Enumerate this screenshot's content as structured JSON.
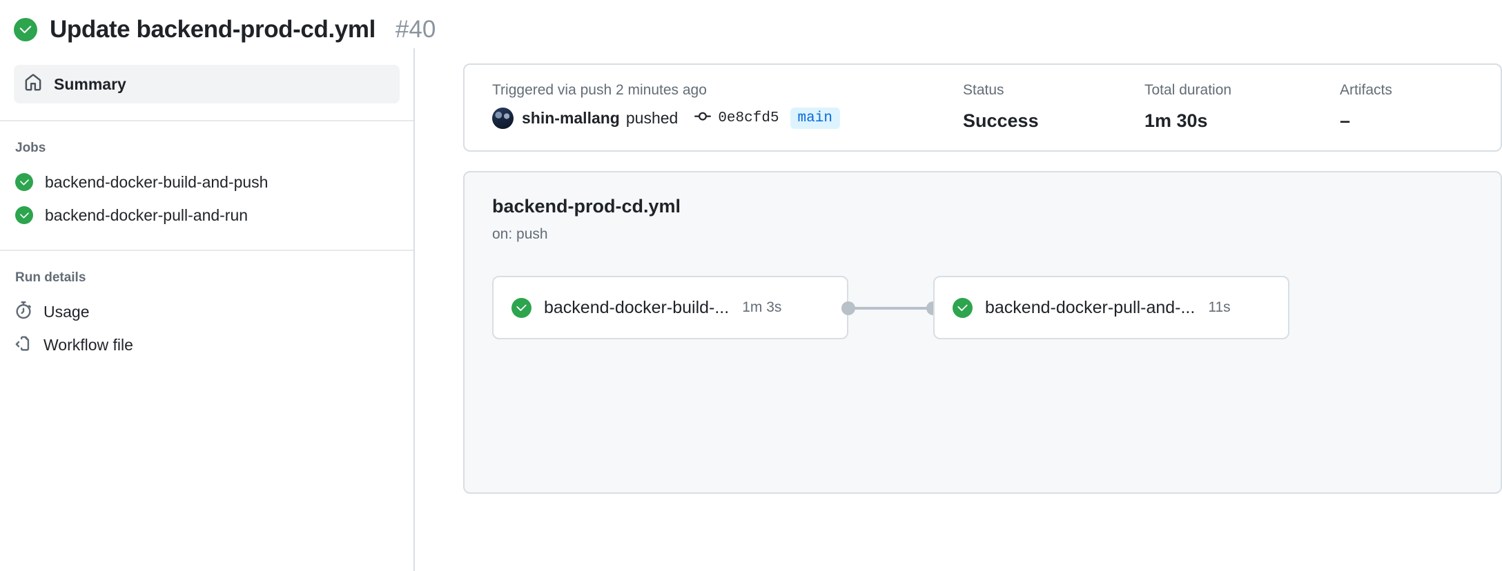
{
  "header": {
    "status_icon": "check-circle-fill-icon",
    "title": "Update backend-prod-cd.yml",
    "run_number": "#40"
  },
  "sidebar": {
    "summary": {
      "icon": "home-icon",
      "label": "Summary"
    },
    "jobs_section_title": "Jobs",
    "jobs": [
      {
        "icon": "check-circle-fill-icon",
        "label": "backend-docker-build-and-push"
      },
      {
        "icon": "check-circle-fill-icon",
        "label": "backend-docker-pull-and-run"
      }
    ],
    "run_details_title": "Run details",
    "run_details": [
      {
        "icon": "stopwatch-icon",
        "label": "Usage"
      },
      {
        "icon": "workflow-file-icon",
        "label": "Workflow file"
      }
    ]
  },
  "summary_card": {
    "trigger_label": "Triggered via push 2 minutes ago",
    "actor": "shin-mallang",
    "action": "pushed",
    "commit_icon": "git-commit-icon",
    "commit_sha": "0e8cfd5",
    "branch": "main",
    "status_label": "Status",
    "status_value": "Success",
    "duration_label": "Total duration",
    "duration_value": "1m 30s",
    "artifacts_label": "Artifacts",
    "artifacts_value": "–"
  },
  "graph_card": {
    "workflow_name": "backend-prod-cd.yml",
    "trigger": "on: push",
    "nodes": [
      {
        "icon": "check-circle-fill-icon",
        "label": "backend-docker-build-...",
        "duration": "1m 3s"
      },
      {
        "icon": "check-circle-fill-icon",
        "label": "backend-docker-pull-and-...",
        "duration": "11s"
      }
    ]
  },
  "colors": {
    "success_green": "#2da44e",
    "branch_badge_bg": "#ddf4ff",
    "branch_badge_fg": "#0969da",
    "muted_text": "#636c76",
    "border": "#d8dee4",
    "card_tint": "#f6f8fa"
  }
}
